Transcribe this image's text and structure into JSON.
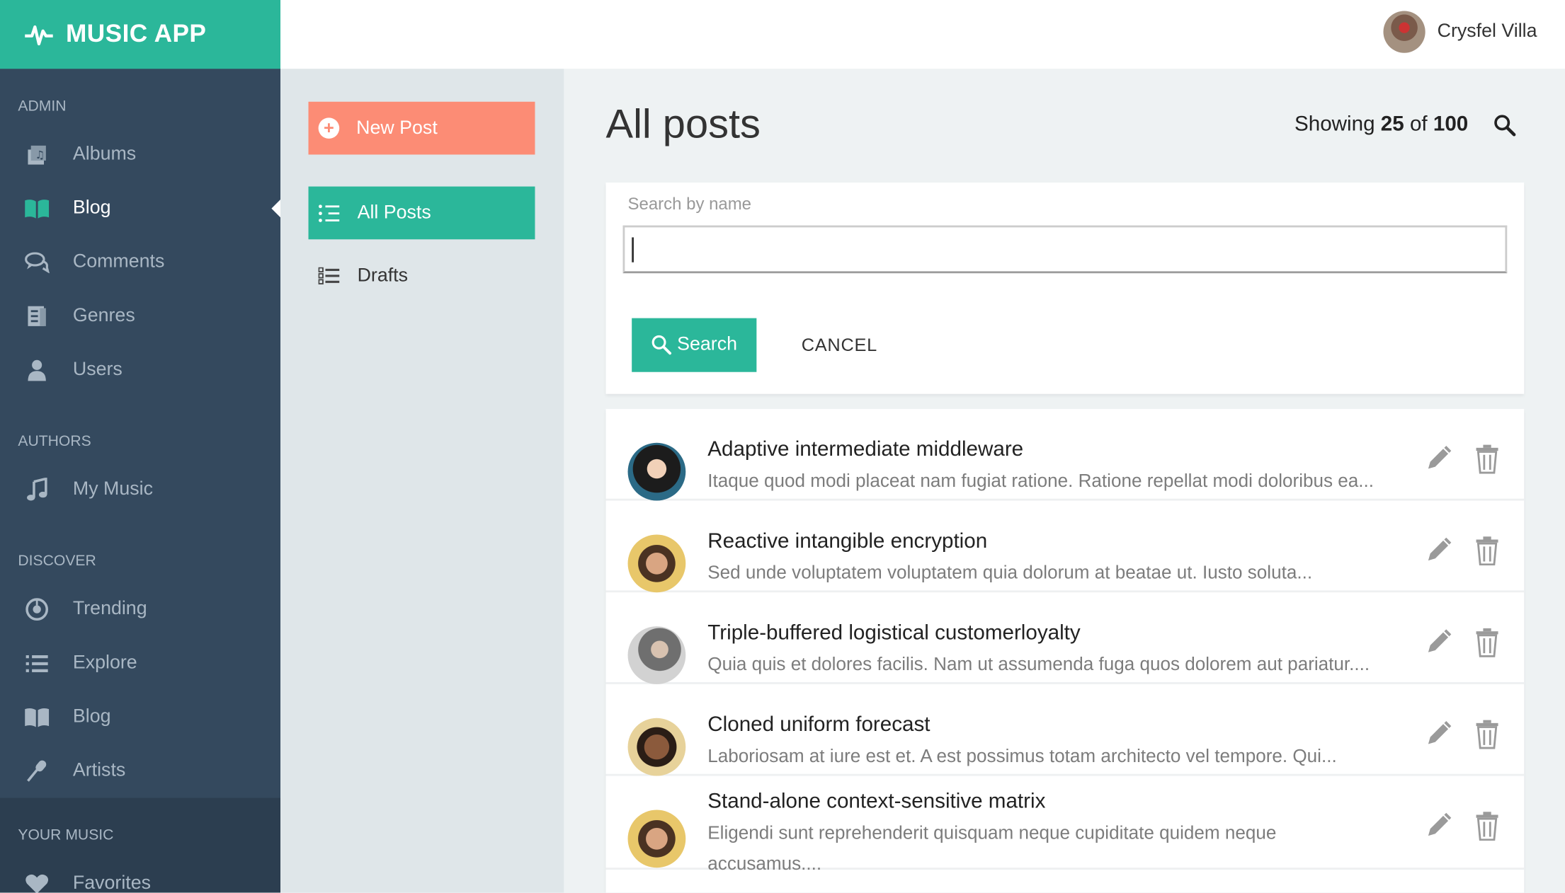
{
  "app": {
    "name": "MUSIC APP"
  },
  "colors": {
    "accent": "#2bb79a",
    "new_post": "#fc8c75",
    "sidebar": "#34495e"
  },
  "user": {
    "name": "Crysfel Villa"
  },
  "sidebar": {
    "sections": [
      {
        "title": "ADMIN",
        "items": [
          {
            "label": "Albums",
            "icon": "album-icon"
          },
          {
            "label": "Blog",
            "icon": "book-icon",
            "active": true
          },
          {
            "label": "Comments",
            "icon": "comments-icon"
          },
          {
            "label": "Genres",
            "icon": "genres-icon"
          },
          {
            "label": "Users",
            "icon": "user-icon"
          }
        ]
      },
      {
        "title": "AUTHORS",
        "items": [
          {
            "label": "My Music",
            "icon": "music-note-icon"
          }
        ]
      },
      {
        "title": "DISCOVER",
        "items": [
          {
            "label": "Trending",
            "icon": "trending-icon"
          },
          {
            "label": "Explore",
            "icon": "list-icon"
          },
          {
            "label": "Blog",
            "icon": "book-icon"
          },
          {
            "label": "Artists",
            "icon": "microphone-icon"
          }
        ]
      },
      {
        "title": "YOUR MUSIC",
        "items": [
          {
            "label": "Favorites",
            "icon": "heart-icon"
          }
        ]
      }
    ]
  },
  "submenu": {
    "new_post": "New Post",
    "all_posts": "All Posts",
    "drafts": "Drafts"
  },
  "main": {
    "title": "All posts",
    "showing_prefix": "Showing",
    "showing_count": "25",
    "showing_of": "of",
    "showing_total": "100",
    "search": {
      "label": "Search by name",
      "value": "",
      "button": "Search",
      "cancel": "CANCEL"
    },
    "posts": [
      {
        "title": "Adaptive intermediate middleware",
        "excerpt": "Itaque quod modi placeat nam fugiat ratione. Ratione repellat modi doloribus ea..."
      },
      {
        "title": "Reactive intangible encryption",
        "excerpt": "Sed unde voluptatem voluptatem quia dolorum at beatae ut. Iusto soluta..."
      },
      {
        "title": "Triple-buffered logistical customerloyalty",
        "excerpt": "Quia quis et dolores facilis. Nam ut assumenda fuga quos dolorem aut pariatur...."
      },
      {
        "title": "Cloned uniform forecast",
        "excerpt": "Laboriosam at iure est et. A est possimus totam architecto vel tempore. Qui..."
      },
      {
        "title": "Stand-alone context-sensitive matrix",
        "excerpt": "Eligendi sunt reprehenderit quisquam neque cupiditate quidem neque accusamus...."
      }
    ]
  }
}
